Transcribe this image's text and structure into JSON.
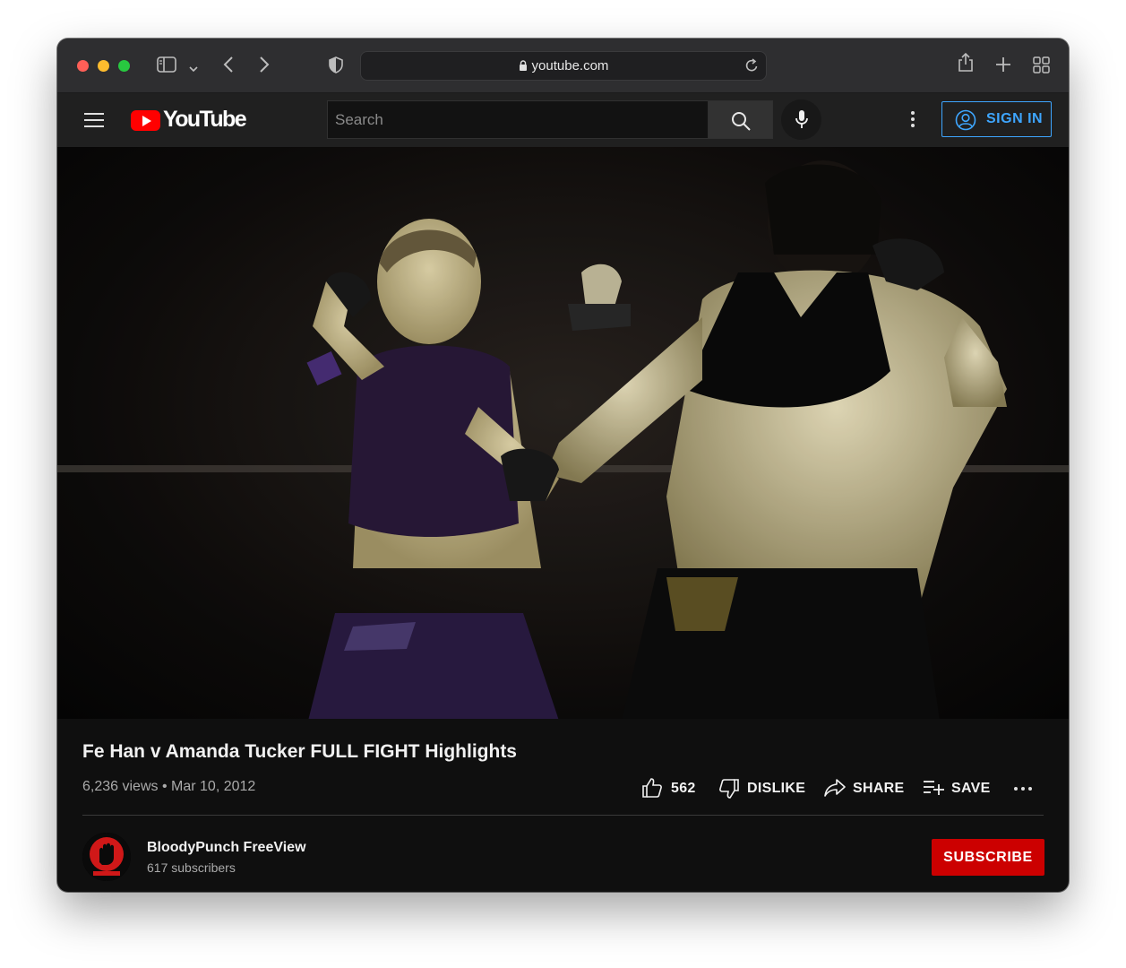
{
  "browser": {
    "url": "youtube.com"
  },
  "header": {
    "logo_text": "YouTube",
    "search_placeholder": "Search",
    "signin_label": "SIGN IN"
  },
  "video": {
    "thumbnail_description": "Two female MMA fighters exchanging punches in a dark arena",
    "title": "Fe Han v Amanda Tucker FULL FIGHT Highlights",
    "views": "6,236 views",
    "separator": "•",
    "date": "Mar 10, 2012",
    "likes": "562",
    "dislike_label": "DISLIKE",
    "share_label": "SHARE",
    "save_label": "SAVE"
  },
  "channel": {
    "name": "BloodyPunch FreeView",
    "subscribers": "617 subscribers",
    "subscribe_label": "SUBSCRIBE"
  },
  "colors": {
    "accent_blue": "#3ea6ff",
    "subscribe_red": "#cc0000",
    "youtube_red": "#ff0000"
  }
}
